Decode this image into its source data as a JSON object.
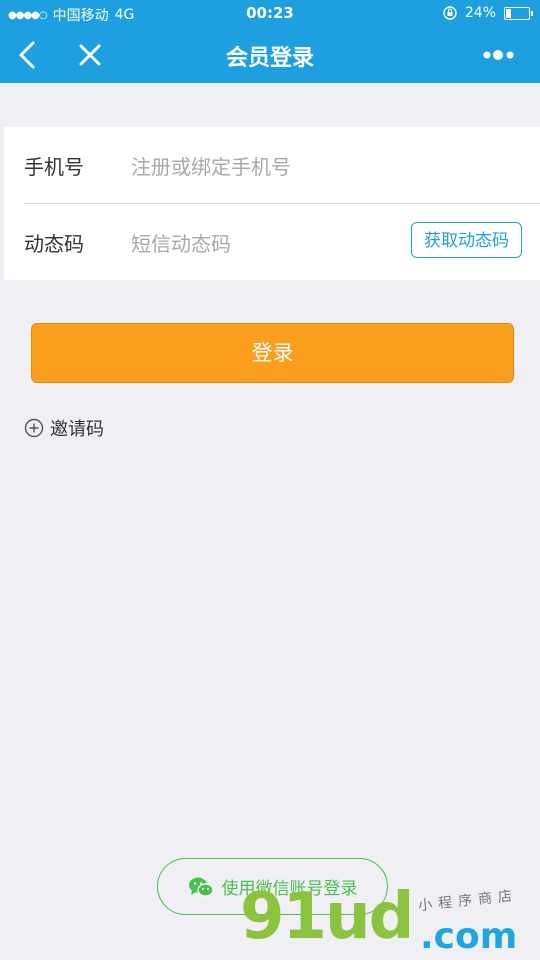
{
  "status_bar": {
    "signal_dots": "●●●●○",
    "carrier": "中国移动",
    "network": "4G",
    "time": "00:23",
    "battery": "24%",
    "battery_level": 0.24
  },
  "nav": {
    "title": "会员登录",
    "icons": [
      "back-chevron-icon",
      "close-icon",
      "more-dots-icon"
    ]
  },
  "form": {
    "phone": {
      "label": "手机号",
      "placeholder": "注册或绑定手机号"
    },
    "code": {
      "label": "动态码",
      "placeholder": "短信动态码",
      "button": "获取动态码"
    }
  },
  "login_button": "登录",
  "invite": {
    "label": "邀请码",
    "icon": "plus-circle-icon"
  },
  "wechat_login": {
    "label": "使用微信账号登录",
    "icon": "wechat-icon"
  },
  "watermark": {
    "main": "91ud",
    "domain": ".com",
    "tagline": "小程序商店"
  },
  "colors": {
    "primary": "#1d9fe0",
    "accent": "#fb9d1d",
    "wechat": "#4bc04e",
    "background": "#efeff4"
  }
}
